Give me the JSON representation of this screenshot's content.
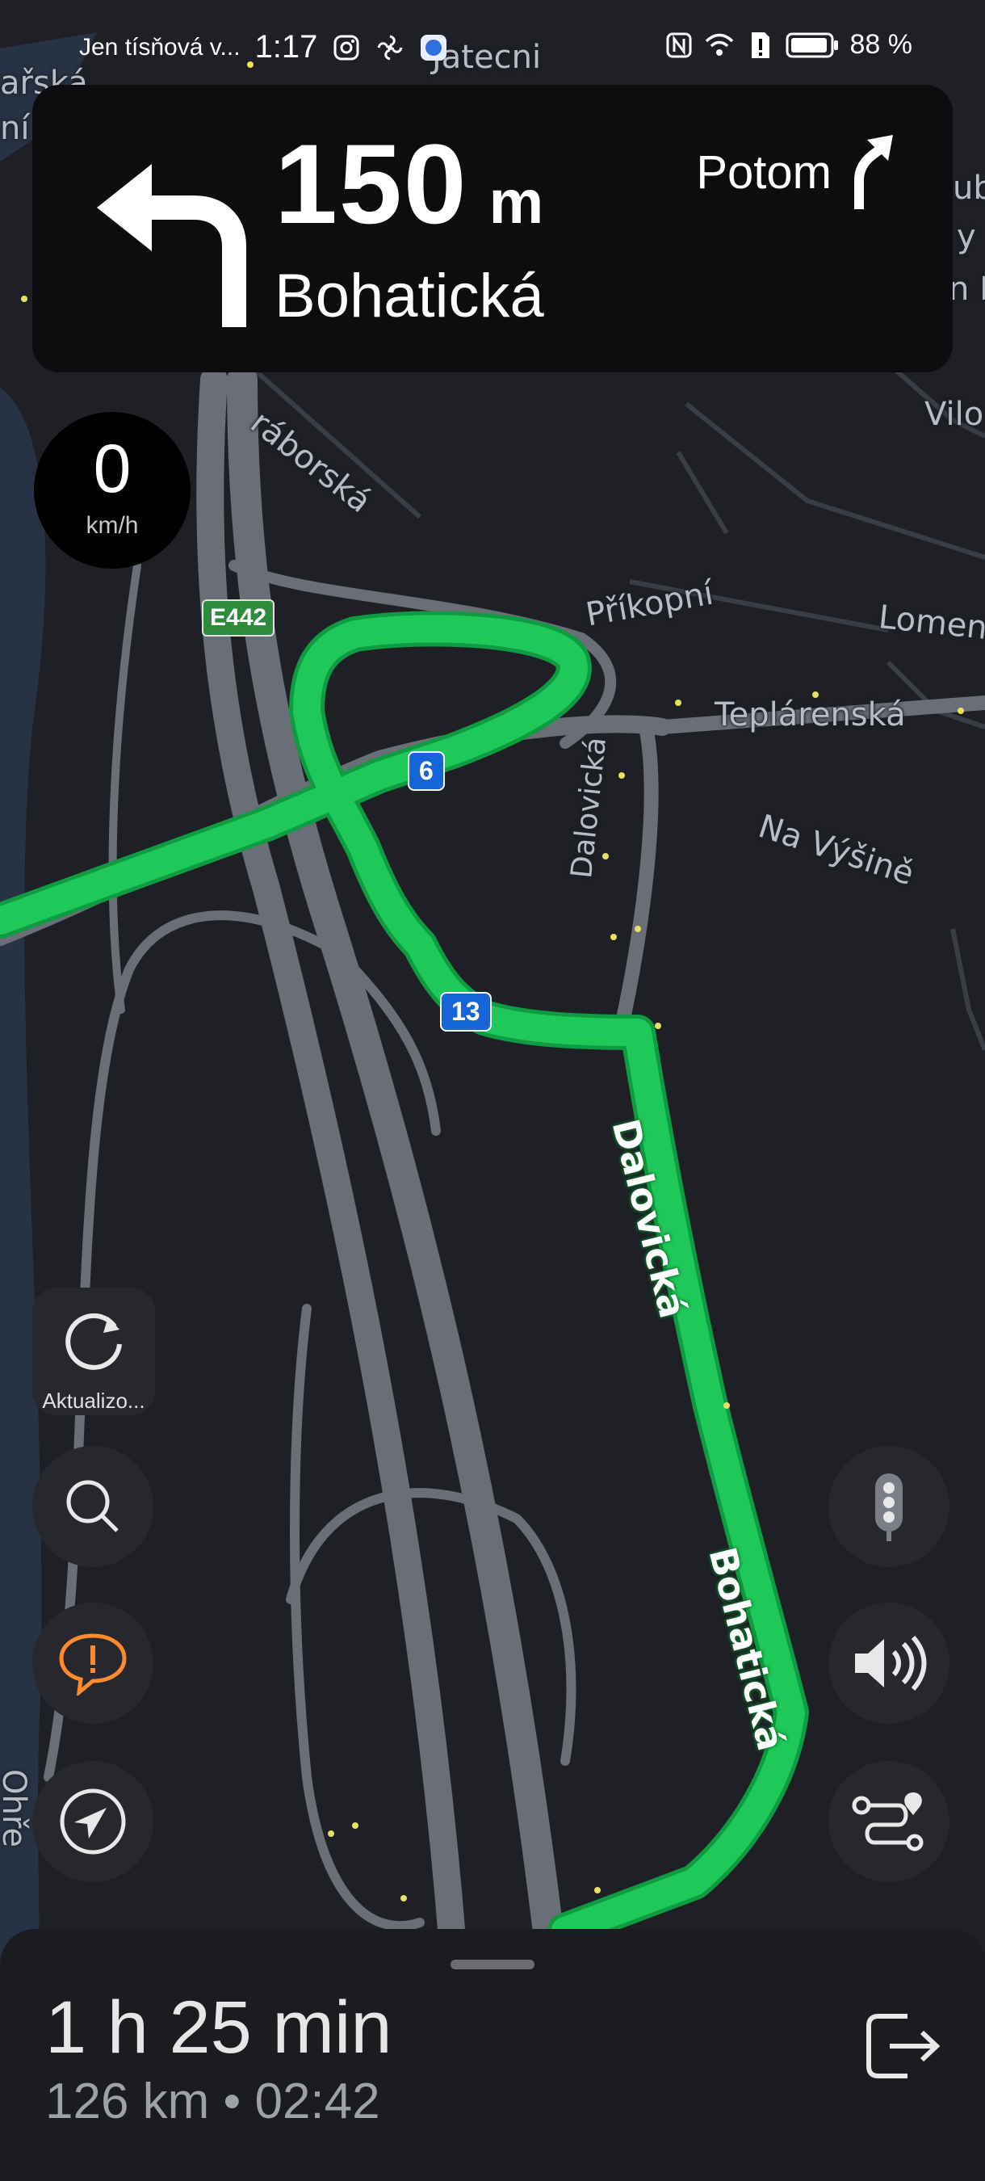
{
  "status_bar": {
    "carrier": "Jen tísňová v...",
    "time": "1:17",
    "battery": "88 %"
  },
  "navigation": {
    "distance_value": "150",
    "distance_unit": "m",
    "street": "Bohatická",
    "then_label": "Potom",
    "turn_icon": "turn-left-arrow-icon",
    "then_icon": "slight-right-arrow-icon"
  },
  "speed": {
    "value": "0",
    "unit": "km/h"
  },
  "map": {
    "labels": [
      "ařská",
      "ní",
      "Jatecni",
      "ub",
      "y",
      "n L",
      "ráborská",
      "Vilo",
      "Příkopní",
      "Lomen",
      "Teplárenská",
      "Na Výšině",
      "Dalovická",
      "Ohře"
    ],
    "route_labels": [
      "Dalovická",
      "Bohatická"
    ],
    "shields": [
      "6",
      "13"
    ],
    "e_shield": "E442",
    "route_color": "#1ec95a",
    "road_color": "#70747d"
  },
  "controls": {
    "refresh_label": "Aktualizo...",
    "left_icons": [
      "refresh-icon",
      "search-icon",
      "report-icon",
      "locate-icon"
    ],
    "right_icons": [
      "traffic-light-icon",
      "volume-icon",
      "route-options-icon"
    ]
  },
  "trip": {
    "duration": "1 h 25 min",
    "summary": "126 km • 02:42"
  }
}
